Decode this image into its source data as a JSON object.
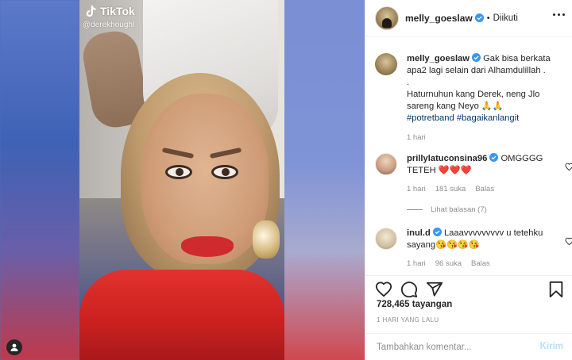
{
  "media": {
    "watermark_brand": "TikTok",
    "watermark_handle": "@derekhoughl",
    "user_tag_icon": "person-icon"
  },
  "post": {
    "author": "melly_goeslaw",
    "follow_status": "Diikuti",
    "separator": "•",
    "caption_line1": "Gak bisa berkata apa2 lagi selain dari Alhamdulillah .",
    "caption_line2": ".",
    "caption_line3": "Haturnuhun kang Derek, neng Jlo sareng kang Neyo 🙏🙏",
    "hashtag1": "#potretband",
    "hashtag2": "#bagaikanlangit",
    "caption_time": "1 hari"
  },
  "comments": [
    {
      "username": "prillylatuconsina96",
      "text": "OMGGGG TETEH ❤️❤️❤️",
      "time": "1 hari",
      "likes": "181 suka",
      "reply": "Balas"
    },
    {
      "username": "inul.d",
      "text": "Laaavvvvvvvvv u tetehku sayang😘😘😘😘",
      "time": "1 hari",
      "likes": "96 suka",
      "reply": "Balas"
    }
  ],
  "view_replies": "Lihat balasan (7)",
  "stats": {
    "views": "728,465 tayangan",
    "date": "1 HARI YANG LALU"
  },
  "composer": {
    "placeholder": "Tambahkan komentar...",
    "post_label": "Kirim"
  },
  "colors": {
    "verified_blue": "#3897f0",
    "heart_red": "#ed4956",
    "link_blue": "#00376b",
    "muted_gray": "#8e8e8e",
    "post_disabled": "#b2dffc"
  }
}
